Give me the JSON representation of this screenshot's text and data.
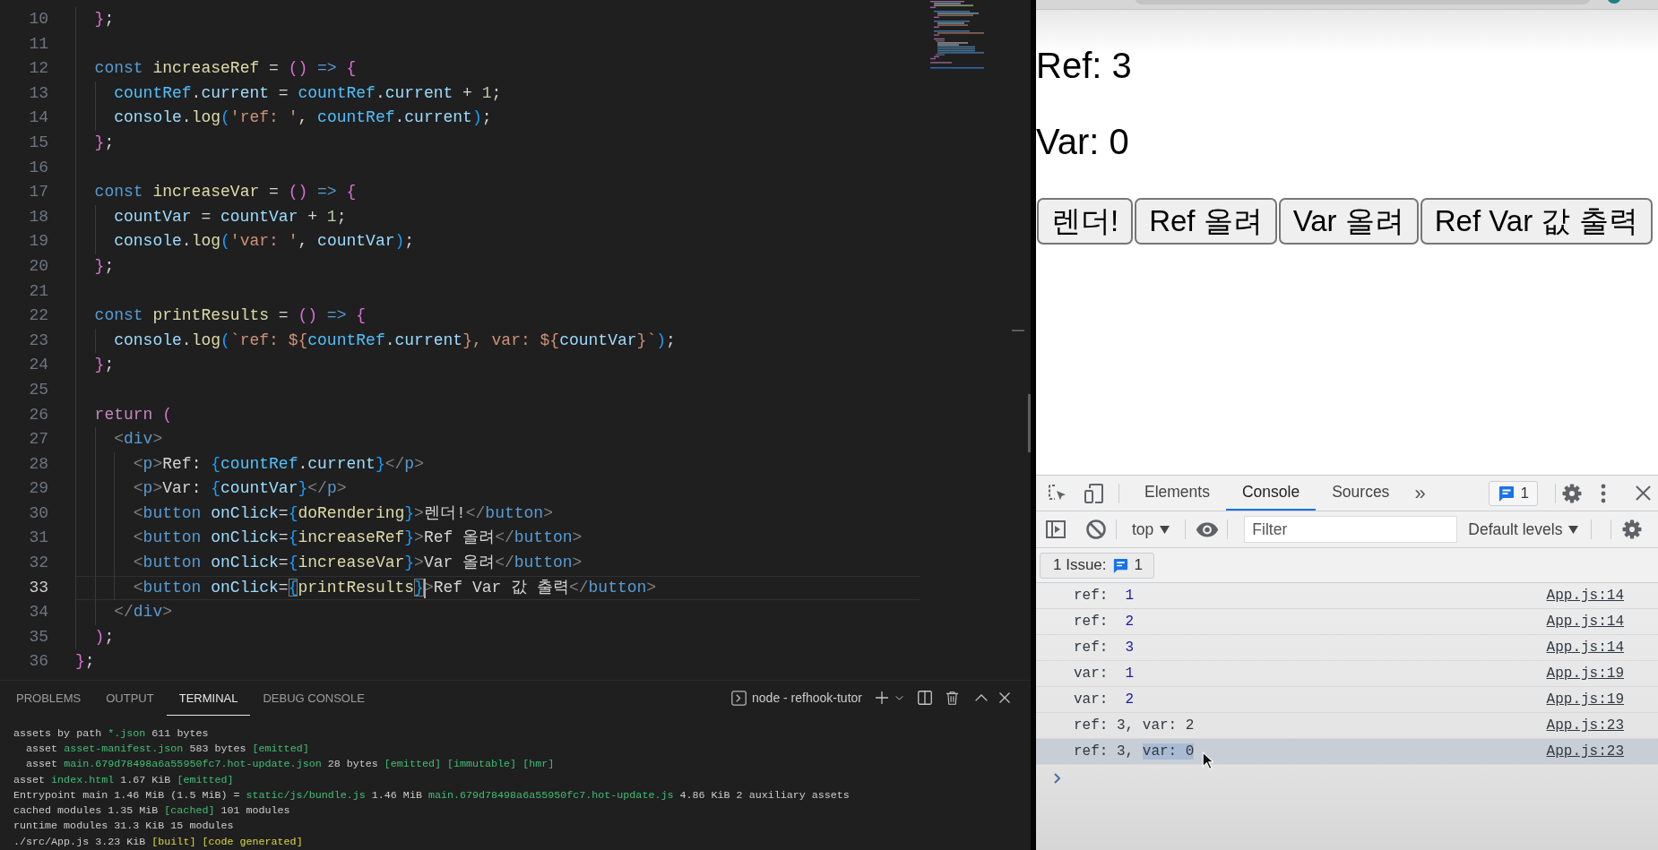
{
  "editor": {
    "lines": [
      {
        "number": "10",
        "active": false,
        "tokens": [
          {
            "kind": "b2",
            "text": "  }"
          },
          {
            "kind": "op",
            "text": ";"
          }
        ]
      },
      {
        "number": "11",
        "active": false
      },
      {
        "number": "12",
        "active": false,
        "tokens": [
          {
            "kind": "kw",
            "text": "  const"
          },
          {
            "kind": "fn",
            "text": " increaseRef"
          },
          {
            "kind": "op",
            "text": " = "
          },
          {
            "kind": "b2",
            "text": "()"
          },
          {
            "kind": "kw",
            "text": " =>"
          },
          {
            "kind": "b2",
            "text": " {"
          }
        ]
      },
      {
        "number": "13",
        "active": false,
        "tokens": [
          {
            "kind": "constant",
            "text": "    countRef"
          },
          {
            "kind": "op",
            "text": "."
          },
          {
            "kind": "var",
            "text": "current"
          },
          {
            "kind": "op",
            "text": " = "
          },
          {
            "kind": "constant",
            "text": "countRef"
          },
          {
            "kind": "op",
            "text": "."
          },
          {
            "kind": "var",
            "text": "current"
          },
          {
            "kind": "op",
            "text": " + "
          },
          {
            "kind": "num",
            "text": "1"
          },
          {
            "kind": "op",
            "text": ";"
          }
        ]
      },
      {
        "number": "14",
        "active": false,
        "tokens": [
          {
            "kind": "var",
            "text": "    console"
          },
          {
            "kind": "op",
            "text": "."
          },
          {
            "kind": "fn",
            "text": "log"
          },
          {
            "kind": "b3",
            "text": "("
          },
          {
            "kind": "str",
            "text": "'ref: '"
          },
          {
            "kind": "op",
            "text": ", "
          },
          {
            "kind": "constant",
            "text": "countRef"
          },
          {
            "kind": "op",
            "text": "."
          },
          {
            "kind": "var",
            "text": "current"
          },
          {
            "kind": "b3",
            "text": ")"
          },
          {
            "kind": "op",
            "text": ";"
          }
        ]
      },
      {
        "number": "15",
        "active": false,
        "tokens": [
          {
            "kind": "b2",
            "text": "  }"
          },
          {
            "kind": "op",
            "text": ";"
          }
        ]
      },
      {
        "number": "16",
        "active": false
      },
      {
        "number": "17",
        "active": false,
        "tokens": [
          {
            "kind": "kw",
            "text": "  const"
          },
          {
            "kind": "fn",
            "text": " increaseVar"
          },
          {
            "kind": "op",
            "text": " = "
          },
          {
            "kind": "b2",
            "text": "()"
          },
          {
            "kind": "kw",
            "text": " =>"
          },
          {
            "kind": "b2",
            "text": " {"
          }
        ]
      },
      {
        "number": "18",
        "active": false,
        "tokens": [
          {
            "kind": "var",
            "text": "    countVar"
          },
          {
            "kind": "op",
            "text": " = "
          },
          {
            "kind": "var",
            "text": "countVar"
          },
          {
            "kind": "op",
            "text": " + "
          },
          {
            "kind": "num",
            "text": "1"
          },
          {
            "kind": "op",
            "text": ";"
          }
        ]
      },
      {
        "number": "19",
        "active": false,
        "tokens": [
          {
            "kind": "var",
            "text": "    console"
          },
          {
            "kind": "op",
            "text": "."
          },
          {
            "kind": "fn",
            "text": "log"
          },
          {
            "kind": "b3",
            "text": "("
          },
          {
            "kind": "str",
            "text": "'var: '"
          },
          {
            "kind": "op",
            "text": ", "
          },
          {
            "kind": "var",
            "text": "countVar"
          },
          {
            "kind": "b3",
            "text": ")"
          },
          {
            "kind": "op",
            "text": ";"
          }
        ]
      },
      {
        "number": "20",
        "active": false,
        "tokens": [
          {
            "kind": "b2",
            "text": "  }"
          },
          {
            "kind": "op",
            "text": ";"
          }
        ]
      },
      {
        "number": "21",
        "active": false
      },
      {
        "number": "22",
        "active": false,
        "tokens": [
          {
            "kind": "kw",
            "text": "  const"
          },
          {
            "kind": "fn",
            "text": " printResults"
          },
          {
            "kind": "op",
            "text": " = "
          },
          {
            "kind": "b2",
            "text": "()"
          },
          {
            "kind": "kw",
            "text": " =>"
          },
          {
            "kind": "b2",
            "text": " {"
          }
        ]
      },
      {
        "number": "23",
        "active": false,
        "tokens": [
          {
            "kind": "var",
            "text": "    console"
          },
          {
            "kind": "op",
            "text": "."
          },
          {
            "kind": "fn",
            "text": "log"
          },
          {
            "kind": "b3",
            "text": "("
          },
          {
            "kind": "str",
            "text": "`ref: ${"
          },
          {
            "kind": "constant",
            "text": "countRef"
          },
          {
            "kind": "op",
            "text": "."
          },
          {
            "kind": "var",
            "text": "current"
          },
          {
            "kind": "str",
            "text": "}, var: ${"
          },
          {
            "kind": "var",
            "text": "countVar"
          },
          {
            "kind": "str",
            "text": "}`"
          },
          {
            "kind": "b3",
            "text": ")"
          },
          {
            "kind": "op",
            "text": ";"
          }
        ]
      },
      {
        "number": "24",
        "active": false,
        "tokens": [
          {
            "kind": "b2",
            "text": "  }"
          },
          {
            "kind": "op",
            "text": ";"
          }
        ]
      },
      {
        "number": "25",
        "active": false
      },
      {
        "number": "26",
        "active": false,
        "tokens": [
          {
            "kind": "ctl",
            "text": "  return"
          },
          {
            "kind": "b2",
            "text": " ("
          }
        ]
      },
      {
        "number": "27",
        "active": false,
        "tokens": [
          {
            "kind": "ang",
            "text": "    <"
          },
          {
            "kind": "tag",
            "text": "div"
          },
          {
            "kind": "ang",
            "text": ">"
          }
        ]
      },
      {
        "number": "28",
        "active": false,
        "tokens": [
          {
            "kind": "ang",
            "text": "      <"
          },
          {
            "kind": "tag",
            "text": "p"
          },
          {
            "kind": "ang",
            "text": ">"
          },
          {
            "kind": "text",
            "text": "Ref: "
          },
          {
            "kind": "b3",
            "text": "{"
          },
          {
            "kind": "constant",
            "text": "countRef"
          },
          {
            "kind": "op",
            "text": "."
          },
          {
            "kind": "var",
            "text": "current"
          },
          {
            "kind": "b3",
            "text": "}"
          },
          {
            "kind": "ang",
            "text": "</"
          },
          {
            "kind": "tag",
            "text": "p"
          },
          {
            "kind": "ang",
            "text": ">"
          }
        ]
      },
      {
        "number": "29",
        "active": false,
        "tokens": [
          {
            "kind": "ang",
            "text": "      <"
          },
          {
            "kind": "tag",
            "text": "p"
          },
          {
            "kind": "ang",
            "text": ">"
          },
          {
            "kind": "text",
            "text": "Var: "
          },
          {
            "kind": "b3",
            "text": "{"
          },
          {
            "kind": "var",
            "text": "countVar"
          },
          {
            "kind": "b3",
            "text": "}"
          },
          {
            "kind": "ang",
            "text": "</"
          },
          {
            "kind": "tag",
            "text": "p"
          },
          {
            "kind": "ang",
            "text": ">"
          }
        ]
      },
      {
        "number": "30",
        "active": false,
        "tokens": [
          {
            "kind": "ang",
            "text": "      <"
          },
          {
            "kind": "tag",
            "text": "button"
          },
          {
            "kind": "attr",
            "text": " onClick"
          },
          {
            "kind": "op",
            "text": "="
          },
          {
            "kind": "b3",
            "text": "{"
          },
          {
            "kind": "fn",
            "text": "doRendering"
          },
          {
            "kind": "b3",
            "text": "}"
          },
          {
            "kind": "ang",
            "text": ">"
          },
          {
            "kind": "text",
            "text": "렌더!"
          },
          {
            "kind": "ang",
            "text": "</"
          },
          {
            "kind": "tag",
            "text": "button"
          },
          {
            "kind": "ang",
            "text": ">"
          }
        ]
      },
      {
        "number": "31",
        "active": false,
        "tokens": [
          {
            "kind": "ang",
            "text": "      <"
          },
          {
            "kind": "tag",
            "text": "button"
          },
          {
            "kind": "attr",
            "text": " onClick"
          },
          {
            "kind": "op",
            "text": "="
          },
          {
            "kind": "b3",
            "text": "{"
          },
          {
            "kind": "fn",
            "text": "increaseRef"
          },
          {
            "kind": "b3",
            "text": "}"
          },
          {
            "kind": "ang",
            "text": ">"
          },
          {
            "kind": "text",
            "text": "Ref 올려"
          },
          {
            "kind": "ang",
            "text": "</"
          },
          {
            "kind": "tag",
            "text": "button"
          },
          {
            "kind": "ang",
            "text": ">"
          }
        ]
      },
      {
        "number": "32",
        "active": false,
        "tokens": [
          {
            "kind": "ang",
            "text": "      <"
          },
          {
            "kind": "tag",
            "text": "button"
          },
          {
            "kind": "attr",
            "text": " onClick"
          },
          {
            "kind": "op",
            "text": "="
          },
          {
            "kind": "b3",
            "text": "{"
          },
          {
            "kind": "fn",
            "text": "increaseVar"
          },
          {
            "kind": "b3",
            "text": "}"
          },
          {
            "kind": "ang",
            "text": ">"
          },
          {
            "kind": "text",
            "text": "Var 올려"
          },
          {
            "kind": "ang",
            "text": "</"
          },
          {
            "kind": "tag",
            "text": "button"
          },
          {
            "kind": "ang",
            "text": ">"
          }
        ]
      },
      {
        "number": "33",
        "active": true,
        "tokens": [
          {
            "kind": "ang",
            "text": "      <"
          },
          {
            "kind": "tag",
            "text": "button"
          },
          {
            "kind": "attr",
            "text": " onClick"
          },
          {
            "kind": "op",
            "text": "="
          },
          {
            "kind": "bracket-match",
            "text": "{"
          },
          {
            "kind": "fn",
            "text": "printResults"
          },
          {
            "kind": "bracket-match",
            "text": "}"
          },
          {
            "kind": "caret"
          },
          {
            "kind": "ang",
            "text": ">"
          },
          {
            "kind": "text",
            "text": "Ref Var 값 출력"
          },
          {
            "kind": "ang",
            "text": "</"
          },
          {
            "kind": "tag",
            "text": "button"
          },
          {
            "kind": "ang",
            "text": ">"
          }
        ]
      },
      {
        "number": "34",
        "active": false,
        "tokens": [
          {
            "kind": "ang",
            "text": "    </"
          },
          {
            "kind": "tag",
            "text": "div"
          },
          {
            "kind": "ang",
            "text": ">"
          }
        ]
      },
      {
        "number": "35",
        "active": false,
        "tokens": [
          {
            "kind": "b2",
            "text": "  )"
          },
          {
            "kind": "op",
            "text": ";"
          }
        ]
      },
      {
        "number": "36",
        "active": false,
        "tokens": [
          {
            "kind": "b2",
            "text": "}"
          },
          {
            "kind": "op",
            "text": ";"
          }
        ]
      }
    ]
  },
  "panel": {
    "tabs": [
      {
        "label": "PROBLEMS",
        "selected": false
      },
      {
        "label": "OUTPUT",
        "selected": false
      },
      {
        "label": "TERMINAL",
        "selected": true
      },
      {
        "label": "DEBUG CONSOLE",
        "selected": false
      }
    ],
    "terminal_name": "node - refhook-tutor",
    "lines": [
      {
        "segments": [
          {
            "kind": "plain",
            "text": "assets by path "
          },
          {
            "kind": "path",
            "text": "*.json"
          },
          {
            "kind": "plain",
            "text": " 611 bytes"
          }
        ]
      },
      {
        "segments": [
          {
            "kind": "plain",
            "text": "  asset "
          },
          {
            "kind": "path",
            "text": "asset-manifest.json"
          },
          {
            "kind": "plain",
            "text": " 583 bytes "
          },
          {
            "kind": "tag",
            "text": "[emitted]"
          }
        ]
      },
      {
        "segments": [
          {
            "kind": "plain",
            "text": "  asset "
          },
          {
            "kind": "path",
            "text": "main.679d78498a6a55950fc7.hot-update.json"
          },
          {
            "kind": "plain",
            "text": " 28 bytes "
          },
          {
            "kind": "tag",
            "text": "[emitted] [immutable] [hmr]"
          }
        ]
      },
      {
        "segments": [
          {
            "kind": "plain",
            "text": "asset "
          },
          {
            "kind": "path",
            "text": "index.html"
          },
          {
            "kind": "plain",
            "text": " 1.67 KiB "
          },
          {
            "kind": "tag",
            "text": "[emitted]"
          }
        ]
      },
      {
        "segments": [
          {
            "kind": "plain",
            "text": "Entrypoint main 1.46 MiB (1.5 MiB) = "
          },
          {
            "kind": "path",
            "text": "static/js/bundle.js"
          },
          {
            "kind": "plain",
            "text": " 1.46 MiB "
          },
          {
            "kind": "path",
            "text": "main.679d78498a6a55950fc7.hot-update.js"
          },
          {
            "kind": "plain",
            "text": " 4.86 KiB 2 auxiliary assets"
          }
        ]
      },
      {
        "segments": [
          {
            "kind": "plain",
            "text": "cached modules 1.35 MiB "
          },
          {
            "kind": "tag",
            "text": "[cached]"
          },
          {
            "kind": "plain",
            "text": " 101 modules"
          }
        ]
      },
      {
        "segments": [
          {
            "kind": "plain",
            "text": "runtime modules 31.3 KiB 15 modules"
          }
        ]
      },
      {
        "segments": [
          {
            "kind": "plain",
            "text": "./src/App.js 3.23 KiB "
          },
          {
            "kind": "built",
            "text": "[built] [code generated]"
          }
        ]
      }
    ]
  },
  "browser": {
    "paragraphs": [
      "Ref: 3",
      "Var: 0"
    ],
    "buttons": [
      "렌더!",
      "Ref 올려",
      "Var 올려",
      "Ref Var 값 출력"
    ]
  },
  "devtools": {
    "tabs": [
      {
        "label": "Elements",
        "selected": false
      },
      {
        "label": "Console",
        "selected": true
      },
      {
        "label": "Sources",
        "selected": false
      }
    ],
    "more_tabs": "»",
    "issues_count": "1",
    "context": "top",
    "filter": {
      "placeholder": "Filter"
    },
    "levels": "Default levels",
    "issues_button": {
      "label": "1 Issue:",
      "count": "1"
    },
    "messages": [
      {
        "parts": [
          {
            "kind": "label",
            "text": "ref: "
          },
          {
            "kind": "number",
            "text": "1"
          }
        ],
        "source": "App.js:14",
        "selected": false
      },
      {
        "parts": [
          {
            "kind": "label",
            "text": "ref: "
          },
          {
            "kind": "number",
            "text": "2"
          }
        ],
        "source": "App.js:14",
        "selected": false
      },
      {
        "parts": [
          {
            "kind": "label",
            "text": "ref: "
          },
          {
            "kind": "number",
            "text": "3"
          }
        ],
        "source": "App.js:14",
        "selected": false
      },
      {
        "parts": [
          {
            "kind": "label",
            "text": "var: "
          },
          {
            "kind": "number",
            "text": "1"
          }
        ],
        "source": "App.js:19",
        "selected": false
      },
      {
        "parts": [
          {
            "kind": "label",
            "text": "var: "
          },
          {
            "kind": "number",
            "text": "2"
          }
        ],
        "source": "App.js:19",
        "selected": false
      },
      {
        "parts": [
          {
            "kind": "label",
            "text": "ref: 3, var: 2"
          }
        ],
        "source": "App.js:23",
        "selected": false
      },
      {
        "parts": [
          {
            "kind": "label",
            "text": "ref: 3, "
          },
          {
            "kind": "highlighted",
            "text": "var: 0"
          }
        ],
        "source": "App.js:23",
        "selected": true
      }
    ]
  }
}
